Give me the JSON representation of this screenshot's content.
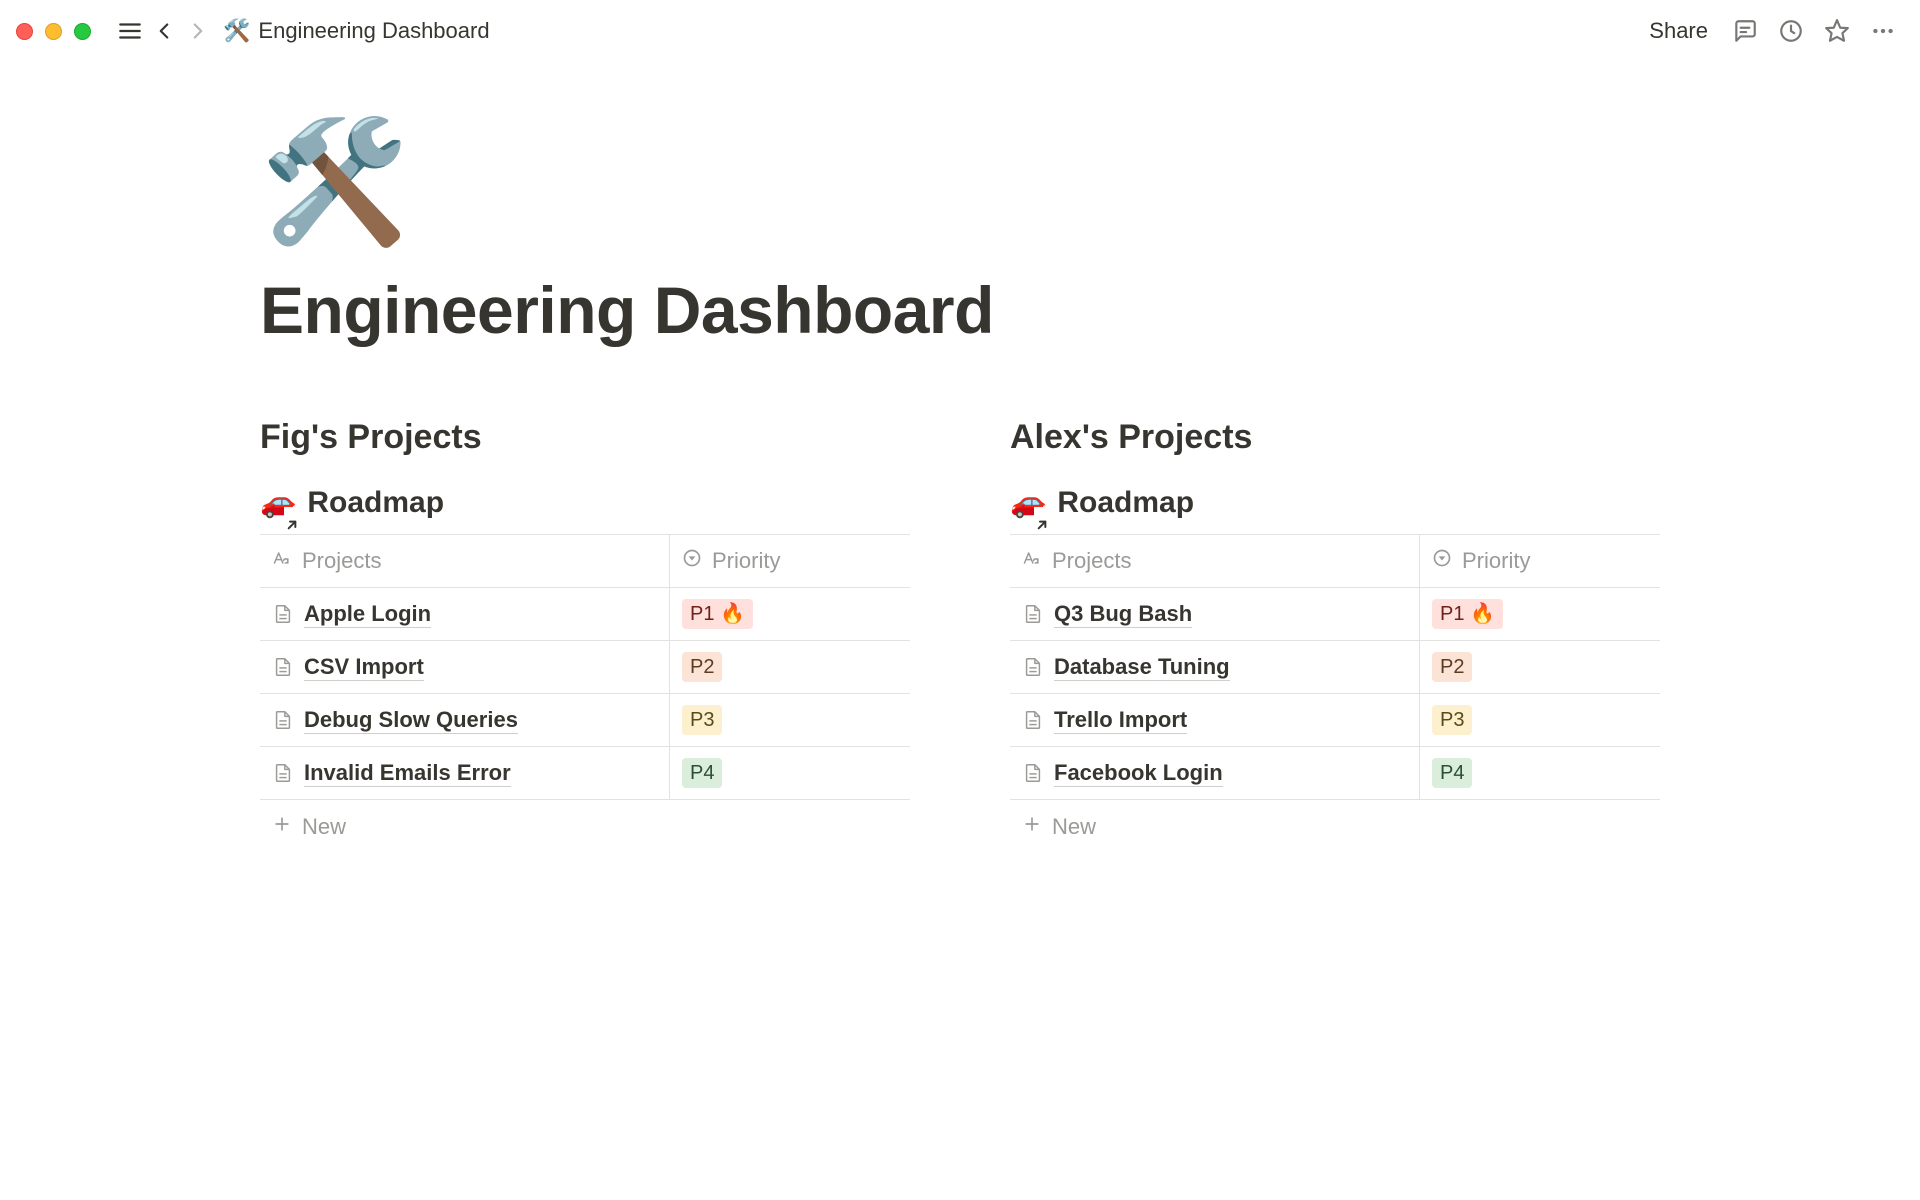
{
  "header": {
    "breadcrumb_icon": "🛠️",
    "breadcrumb_title": "Engineering Dashboard",
    "share_label": "Share"
  },
  "page": {
    "emoji": "🛠️",
    "title": "Engineering Dashboard"
  },
  "columns": [
    {
      "heading": "Fig's Projects",
      "db": {
        "icon": "🚗",
        "title": "Roadmap",
        "col_projects": "Projects",
        "col_priority": "Priority",
        "rows": [
          {
            "name": "Apple Login",
            "priority": "P1 🔥",
            "priority_class": "p1"
          },
          {
            "name": "CSV Import",
            "priority": "P2",
            "priority_class": "p2"
          },
          {
            "name": "Debug Slow Queries",
            "priority": "P3",
            "priority_class": "p3"
          },
          {
            "name": "Invalid Emails Error",
            "priority": "P4",
            "priority_class": "p4"
          }
        ],
        "new_label": "New"
      }
    },
    {
      "heading": "Alex's Projects",
      "db": {
        "icon": "🚗",
        "title": "Roadmap",
        "col_projects": "Projects",
        "col_priority": "Priority",
        "rows": [
          {
            "name": "Q3 Bug Bash",
            "priority": "P1 🔥",
            "priority_class": "p1"
          },
          {
            "name": "Database Tuning",
            "priority": "P2",
            "priority_class": "p2"
          },
          {
            "name": "Trello Import",
            "priority": "P3",
            "priority_class": "p3"
          },
          {
            "name": "Facebook Login",
            "priority": "P4",
            "priority_class": "p4"
          }
        ],
        "new_label": "New"
      }
    }
  ]
}
